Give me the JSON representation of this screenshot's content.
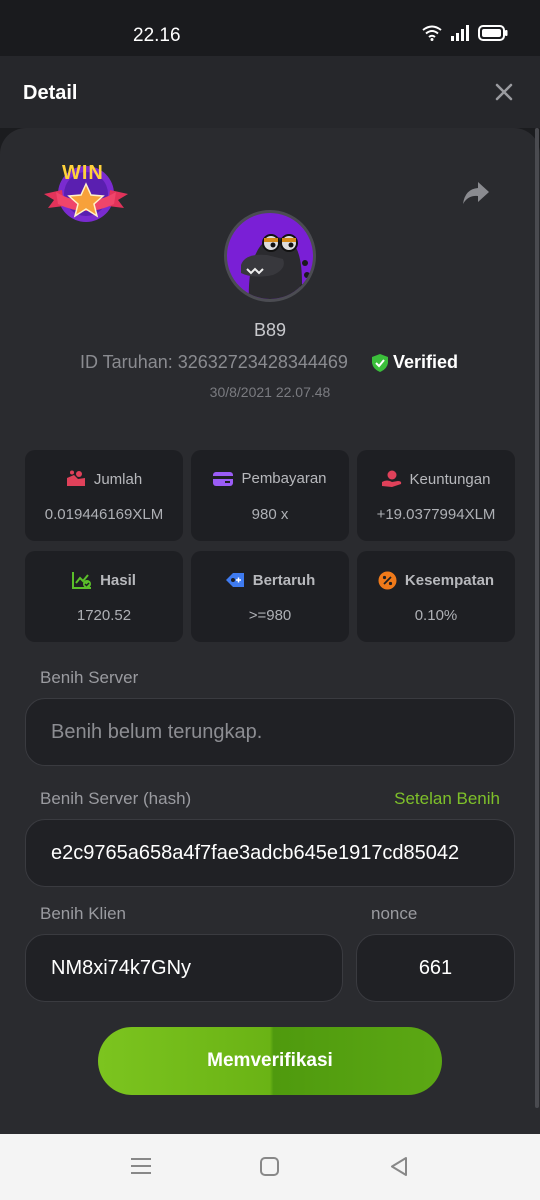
{
  "status": {
    "time": "22.16"
  },
  "header": {
    "title": "Detail"
  },
  "player": {
    "name": "B89",
    "bet_id": "ID Taruhan: 32632723428344469",
    "verified_label": "Verified",
    "datetime": "30/8/2021 22.07.48",
    "badge_text": "WIN"
  },
  "stats": [
    {
      "icon": "coins-icon",
      "label": "Jumlah",
      "value": "0.019446169XLM",
      "color": "#e0415a"
    },
    {
      "icon": "card-icon",
      "label": "Pembayaran",
      "value": "980 x",
      "color": "#9b5cf6"
    },
    {
      "icon": "hand-coin-icon",
      "label": "Keuntungan",
      "value": "+19.0377994XLM",
      "color": "#e0415a"
    },
    {
      "icon": "chart-check-icon",
      "label": "Hasil",
      "value": "1720.52",
      "color": "#5bbf2a"
    },
    {
      "icon": "tag-icon",
      "label": "Bertaruh",
      "value": ">=980",
      "color": "#3f7bf0"
    },
    {
      "icon": "percent-icon",
      "label": "Kesempatan",
      "value": "0.10%",
      "color": "#f07a1a"
    }
  ],
  "seeds": {
    "server_label": "Benih Server",
    "server_placeholder": "Benih belum terungkap.",
    "hash_label": "Benih Server (hash)",
    "hash_value": "e2c9765a658a4f7fae3adcb645e1917cd85042",
    "settings_link": "Setelan Benih",
    "client_label": "Benih Klien",
    "client_value": "NM8xi74k7GNy",
    "nonce_label": "nonce",
    "nonce_value": "661"
  },
  "actions": {
    "verify_label": "Memverifikasi"
  },
  "colors": {
    "accent": "#7ec02a",
    "background": "#2a2b2f",
    "verified": "#3bbf3b"
  }
}
